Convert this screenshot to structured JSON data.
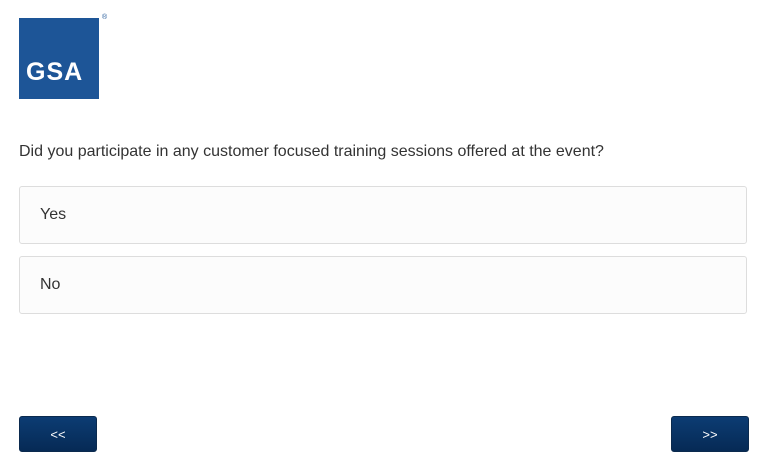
{
  "logo": {
    "text": "GSA",
    "registered": "®",
    "color": "#1d5597"
  },
  "survey": {
    "question": "Did you participate in any customer focused training sessions offered at the event?",
    "options": [
      {
        "label": "Yes"
      },
      {
        "label": "No"
      }
    ]
  },
  "navigation": {
    "prev_label": "<<",
    "next_label": ">>",
    "button_color": "#0b3566"
  }
}
